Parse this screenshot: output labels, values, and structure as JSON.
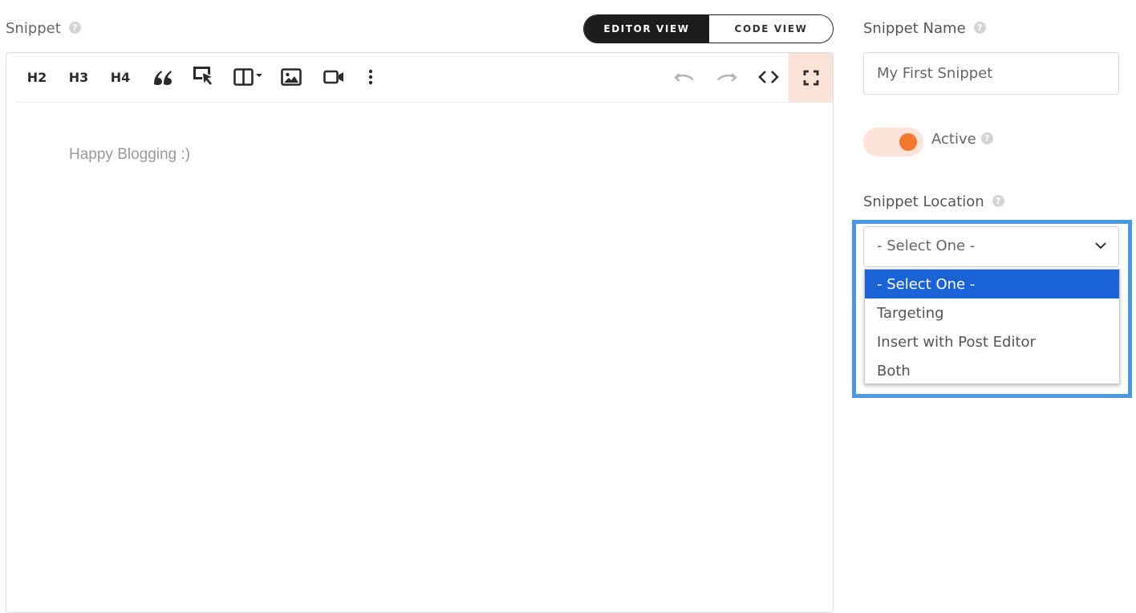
{
  "snippet": {
    "label": "Snippet",
    "help": "?"
  },
  "view_toggle": {
    "editor_view": "EDITOR VIEW",
    "code_view": "CODE VIEW",
    "active": "editor_view"
  },
  "toolbar": {
    "h2": "H2",
    "h3": "H3",
    "h4": "H4",
    "icons": [
      "quote-icon",
      "cursor-select-icon",
      "columns-dropdown-icon",
      "image-icon",
      "video-icon",
      "more-vertical-icon",
      "undo-icon",
      "redo-icon",
      "code-icon",
      "fullscreen-icon"
    ]
  },
  "editor": {
    "placeholder": "Happy Blogging :)"
  },
  "snippet_name": {
    "label": "Snippet Name",
    "help": "?",
    "value": "My First Snippet"
  },
  "active": {
    "label": "Active",
    "help": "?",
    "on": true,
    "accent_color": "#f2772f"
  },
  "snippet_location": {
    "label": "Snippet Location",
    "help": "?",
    "selected": "- Select One -",
    "options": [
      "- Select One -",
      "Targeting",
      "Insert with Post Editor",
      "Both"
    ],
    "highlight_color": "#1a63d6",
    "frame_color": "#4a98e0"
  }
}
